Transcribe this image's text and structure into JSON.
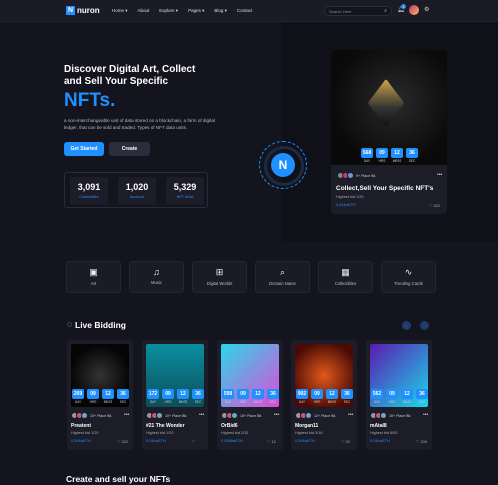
{
  "nav": {
    "logo_letter": "N",
    "logo_text": "nuron",
    "menu": [
      "Home ▾",
      "About",
      "Explore ▾",
      "Pages ▾",
      "Blog ▾",
      "Contact"
    ],
    "search_placeholder": "Search Here",
    "notification_count": "6"
  },
  "hero": {
    "title": "Discover Digital Art, Collect and Sell Your Specific",
    "title_accent": "NFTs.",
    "description": "a non-interchangeable unit of data stored on a blockchain, a form of digital ledger, that can be sold and traded. Types of NFT data units.",
    "primary_button": "Get Started",
    "secondary_button": "Create",
    "stats": [
      {
        "value": "3,091",
        "label": "Collectibles"
      },
      {
        "value": "1,020",
        "label": "Auctions"
      },
      {
        "value": "5,329",
        "label": "NFT Artist"
      }
    ],
    "badge_letter": "N",
    "featured": {
      "timer": [
        {
          "value": "568",
          "unit": "DAY"
        },
        {
          "value": "09",
          "unit": "HRS"
        },
        {
          "value": "12",
          "unit": "MIN'S"
        },
        {
          "value": "36",
          "unit": "SEC"
        }
      ],
      "owners_text": "9+ Place Bit.",
      "title": "Collect,Sell Your Specific NFT's",
      "bid": "Highest bid 1/20",
      "price": "0.244wETH",
      "likes": "322"
    }
  },
  "categories": [
    {
      "icon": "image-icon",
      "glyph": "▣",
      "label": "Art"
    },
    {
      "icon": "music-icon",
      "glyph": "♫",
      "label": "Music"
    },
    {
      "icon": "map-icon",
      "glyph": "⊞",
      "label": "Digital Worlds"
    },
    {
      "icon": "search-icon",
      "glyph": "⌕",
      "label": "Domain Name"
    },
    {
      "icon": "grid-icon",
      "glyph": "▦",
      "label": "Collectibles"
    },
    {
      "icon": "activity-icon",
      "glyph": "∿",
      "label": "Trending Cards"
    }
  ],
  "live_bidding": {
    "title": "Live Bidding",
    "prev": "←",
    "next": "→",
    "cards": [
      {
        "timer": [
          "269",
          "09",
          "12",
          "36"
        ],
        "owners": "15+ Place Bit.",
        "title": "Preatent",
        "bid": "Highest bid 1/20",
        "price": "0.244wETH",
        "likes": "322"
      },
      {
        "timer": [
          "172",
          "09",
          "12",
          "36"
        ],
        "owners": "10+ Place Bit.",
        "title": "#21 The Wonder",
        "bid": "Highest bid 1/20",
        "price": "0.244wETH",
        "likes": ""
      },
      {
        "timer": [
          "598",
          "09",
          "12",
          "36"
        ],
        "owners": "15+ Place Bit.",
        "title": "OrBid6",
        "bid": "Highest bid 2/31",
        "price": "0.3558wETH",
        "likes": "12"
      },
      {
        "timer": [
          "902",
          "09",
          "12",
          "36"
        ],
        "owners": "12+ Place Bit.",
        "title": "Morgan11",
        "bid": "Highest bid 3/16",
        "price": "0.244wETH",
        "likes": "20"
      },
      {
        "timer": [
          "562",
          "09",
          "12",
          "36"
        ],
        "owners": "16+ Place Bit.",
        "title": "mAtal8",
        "bid": "Highest bid 6/50",
        "price": "0.244wETH",
        "likes": "205"
      }
    ],
    "units": [
      "DAY",
      "HRS",
      "MIN'S",
      "SEC"
    ]
  },
  "footer_heading": "Create and sell your NFTs"
}
